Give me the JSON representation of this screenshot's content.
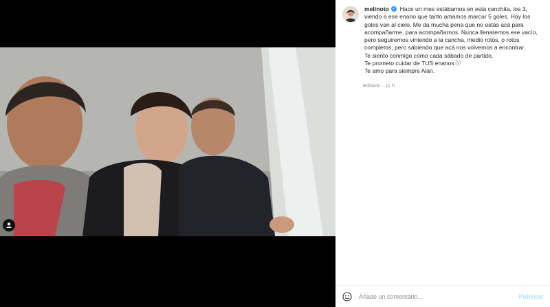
{
  "post": {
    "username": "melinoto",
    "caption_lines": [
      "Hace un mes estábamos en esta canchita, los 3, viendo a ese enano que tanto amamos marcar 5 goles. Hoy los goles van al cielo. Me da mucha pena que no estás acá para acompañarme, para acompañarnos. Nunca llenaremos ese vacío, pero seguiremos viniendo a la cancha, medio rotos, o rotos completos, pero sabiendo que acá nos volvemos a encontrar.",
      "Te siento conmigo como cada sábado de partido.",
      "Te prometo cuidar de TUS enanos🤍",
      "Te amo para siempre Alan."
    ],
    "edited_label": "Editado",
    "time_ago": "11 h"
  },
  "comment": {
    "placeholder": "Añade un comentario...",
    "publish_label": "Publicar"
  },
  "icons": {
    "verified": "verified-badge-icon",
    "tag": "user-tag-icon",
    "emoji": "emoji-icon"
  },
  "colors": {
    "verified": "#3897f0",
    "publish": "#b2dffc",
    "meta_text": "#8e8e8e"
  }
}
